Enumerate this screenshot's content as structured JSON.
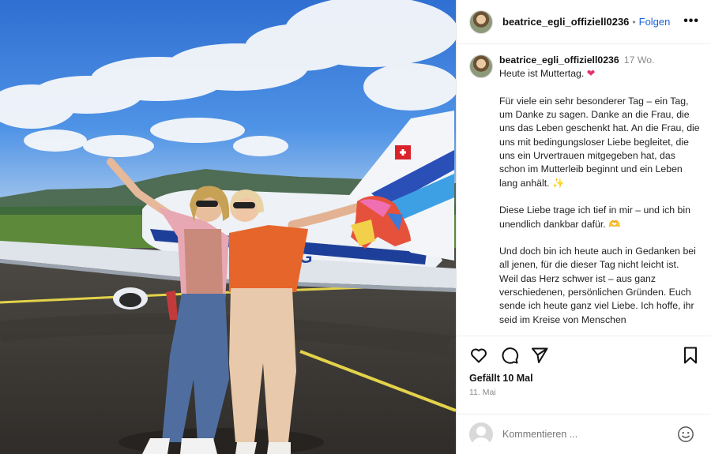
{
  "post": {
    "username": "beatrice_egli_offiziell0236",
    "follow_label": "Folgen",
    "separator": "•",
    "more_label": "•••",
    "time_ago": "17 Wo.",
    "caption_lines": [
      "Heute ist Muttertag.",
      "Für viele ein sehr besonderer Tag – ein Tag, um Danke zu sagen. Danke an die Frau, die uns das Leben geschenkt hat. An die Frau, die uns mit bedingungsloser Liebe begleitet, die uns ein Urvertrauen mitgegeben hat, das schon im Mutterleib beginnt und ein Leben lang anhält.",
      "Diese Liebe trage ich tief in mir – und ich bin unendlich dankbar dafür.",
      "Und doch bin ich heute auch in Gedanken bei all jenen, für die dieser Tag nicht leicht ist.",
      "Weil das Herz schwer ist – aus ganz verschiedenen, persönlichen Gründen. Euch sende ich heute ganz viel Liebe. Ich hoffe, ihr seid im Kreise von Menschen"
    ],
    "emojis": {
      "heart": "❤",
      "sparkles": "✨",
      "hands": "🫶"
    },
    "likes_label": "Gefällt 10 Mal",
    "date_label": "11. Mai",
    "comment_placeholder": "Kommentieren ...",
    "plane_registration": "MG"
  },
  "icons": {
    "like": "heart-icon",
    "comment": "comment-icon",
    "share": "send-icon",
    "save": "bookmark-icon",
    "emoji": "smiley-icon"
  },
  "colors": {
    "follow": "#1a63d8",
    "heart_emoji": "#e8316c",
    "muted": "#8a8a8a"
  }
}
